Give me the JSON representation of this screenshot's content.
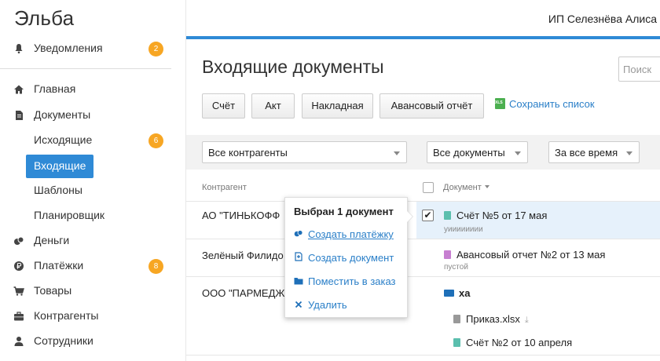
{
  "app": {
    "logo": "Эльба",
    "user": "ИП Селезнёва Алиса"
  },
  "sidebar": {
    "items": [
      {
        "label": "Уведомления",
        "icon": "bell-icon",
        "badge": "2"
      },
      {
        "label": "Главная",
        "icon": "home-icon"
      },
      {
        "label": "Документы",
        "icon": "document-icon"
      },
      {
        "label": "Исходящие",
        "badge": "6"
      },
      {
        "label": "Входящие",
        "active": true
      },
      {
        "label": "Шаблоны"
      },
      {
        "label": "Планировщик"
      },
      {
        "label": "Деньги",
        "icon": "coins-icon"
      },
      {
        "label": "Платёжки",
        "icon": "ruble-icon",
        "badge": "8"
      },
      {
        "label": "Товары",
        "icon": "cart-icon"
      },
      {
        "label": "Контрагенты",
        "icon": "briefcase-icon"
      },
      {
        "label": "Сотрудники",
        "icon": "person-icon"
      }
    ]
  },
  "main": {
    "title": "Входящие документы",
    "search_placeholder": "Поиск",
    "buttons": [
      "Счёт",
      "Акт",
      "Накладная",
      "Авансовый отчёт"
    ],
    "save_list": "Сохранить список",
    "filters": {
      "contractor": "Все контрагенты",
      "documents": "Все документы",
      "period": "За все время"
    },
    "table": {
      "headers": {
        "contractor": "Контрагент",
        "document": "Документ"
      },
      "rows": [
        {
          "contractor": "АО \"ТИНЬКОФФ",
          "document": "Счёт №5 от 17 мая",
          "note": "уииииииии",
          "checked": true
        },
        {
          "contractor": "Зелёный Филидо",
          "document": "Авансовый отчет №2 от 13 мая",
          "note": "пустой"
        },
        {
          "contractor": "ООО \"ПАРМЕДЖ",
          "folder": "ха",
          "files": [
            "Приказ.xlsx",
            "Счёт №2 от 10 апреля"
          ]
        }
      ]
    }
  },
  "popup": {
    "title": "Выбран 1 документ",
    "items": [
      {
        "label": "Создать платёжку",
        "icon": "payment-icon"
      },
      {
        "label": "Создать документ",
        "icon": "create-document-icon"
      },
      {
        "label": "Поместить в заказ",
        "icon": "folder-icon"
      },
      {
        "label": "Удалить",
        "icon": "delete-icon"
      }
    ]
  },
  "colors": {
    "accent": "#2f8ad6",
    "badge": "#f7a623",
    "link": "#2a7fc8",
    "invoice_icon": "#5bbfae",
    "advance_icon": "#c77fd1",
    "xlsx_icon": "#999999"
  }
}
